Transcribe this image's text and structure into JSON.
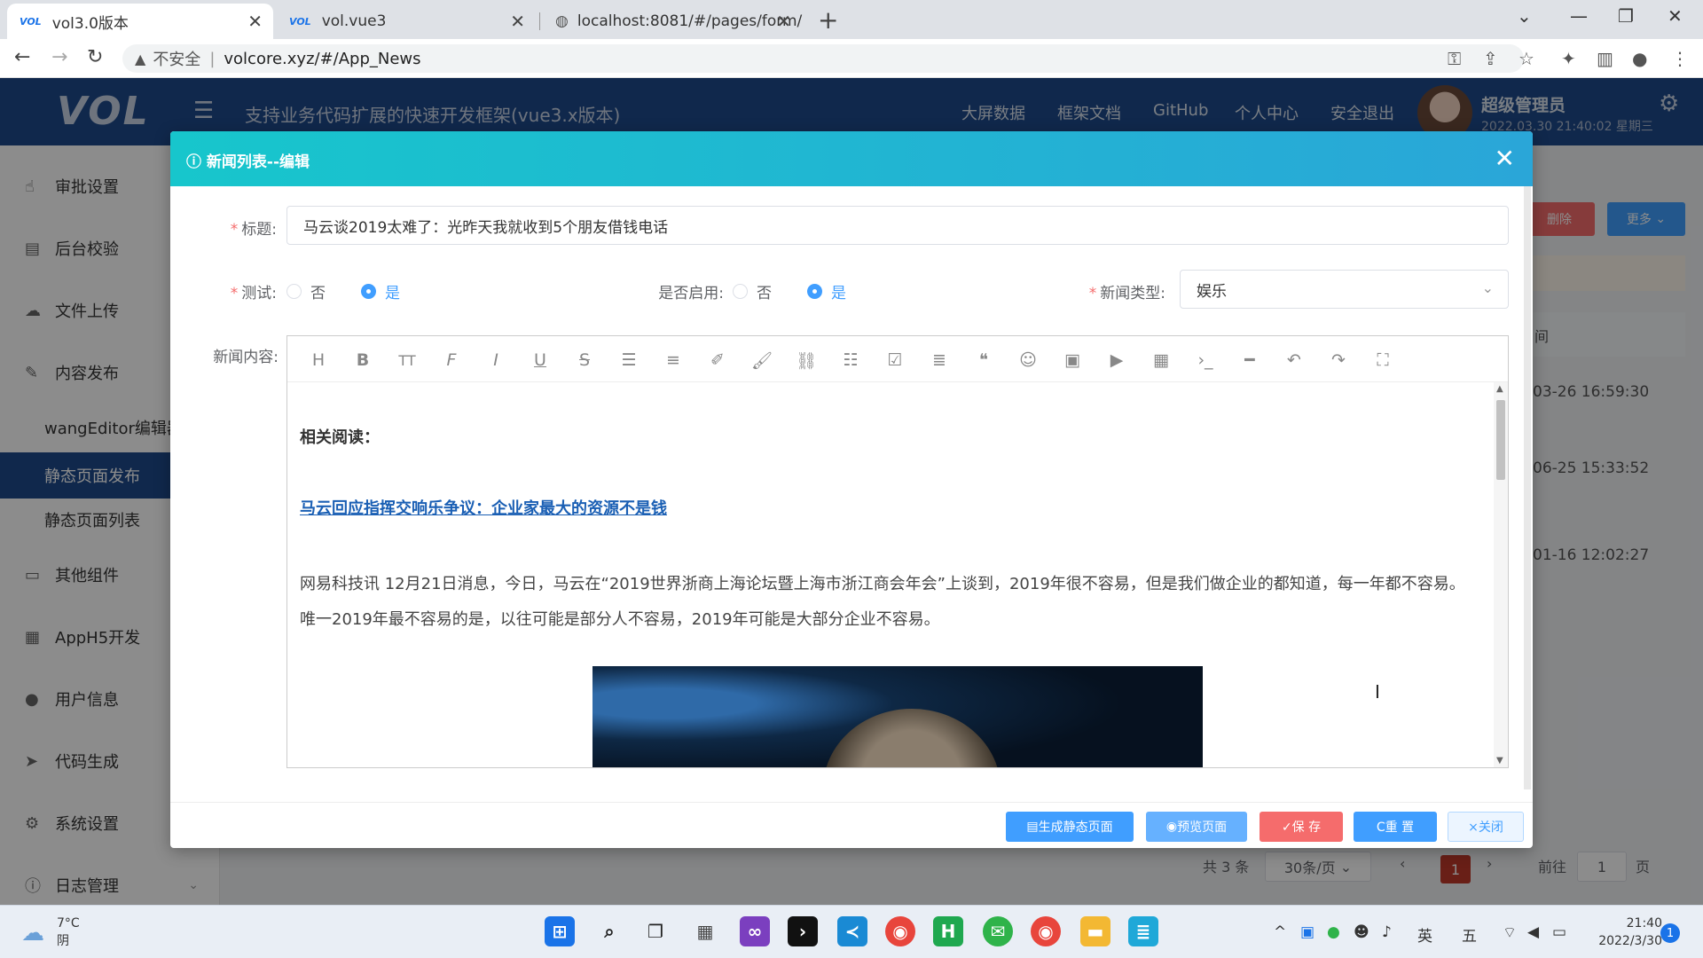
{
  "browser": {
    "tabs": [
      {
        "favicon": "VOL",
        "title": "vol3.0版本"
      },
      {
        "favicon": "VOL",
        "title": "vol.vue3"
      },
      {
        "favicon": "globe-icon",
        "title": "localhost:8081/#/pages/form/"
      }
    ],
    "insecure_label": "不安全",
    "url": "volcore.xyz/#/App_News"
  },
  "app": {
    "logo": "VOL",
    "title": "支持业务代码扩展的快速开发框架(vue3.x版本)",
    "header_links": [
      "大屏数据",
      "框架文档",
      "GitHub",
      "个人中心",
      "安全退出"
    ],
    "user_name": "超级管理员",
    "user_time": "2022.03.30 21:40:02 星期三"
  },
  "sidebar": {
    "items": [
      {
        "icon": "hand-icon",
        "label": "审批设置"
      },
      {
        "icon": "doc-icon",
        "label": "后台校验"
      },
      {
        "icon": "cloud-upload-icon",
        "label": "文件上传"
      },
      {
        "icon": "edit-icon",
        "label": "内容发布"
      },
      {
        "icon": "",
        "label": "wangEditor编辑器"
      },
      {
        "icon": "",
        "label": "静态页面发布"
      },
      {
        "icon": "",
        "label": "静态页面列表"
      },
      {
        "icon": "folder-icon",
        "label": "其他组件"
      },
      {
        "icon": "grid-icon",
        "label": "AppH5开发"
      },
      {
        "icon": "user-icon",
        "label": "用户信息"
      },
      {
        "icon": "send-icon",
        "label": "代码生成"
      },
      {
        "icon": "gear-icon",
        "label": "系统设置"
      },
      {
        "icon": "info-icon",
        "label": "日志管理"
      }
    ]
  },
  "background": {
    "delete_btn": "删除",
    "more_btn": "更多",
    "col_head": "间",
    "times": [
      "03-26 16:59:30",
      "06-25 15:33:52",
      "01-16 12:02:27"
    ],
    "pager": {
      "total": "共 3 条",
      "size": "30条/页",
      "current": "1",
      "goto": "前往",
      "page_input": "1",
      "page_suffix": "页"
    }
  },
  "modal": {
    "title": "新闻列表--编辑",
    "fields": {
      "title_label": "标题:",
      "title_value": "马云谈2019太难了：光昨天我就收到5个朋友借钱电话",
      "test_label": "测试:",
      "test_options": [
        "否",
        "是"
      ],
      "enable_label": "是否启用:",
      "enable_options": [
        "否",
        "是"
      ],
      "type_label": "新闻类型:",
      "type_value": "娱乐",
      "content_label": "新闻内容:"
    },
    "editor": {
      "toolbar": [
        "H",
        "B",
        "TT",
        "F",
        "I",
        "U",
        "S",
        "indent-icon",
        "line-height-icon",
        "pen-icon",
        "brush-icon",
        "link-icon",
        "list-icon",
        "checkbox-icon",
        "align-icon",
        "quote-icon",
        "emoji-icon",
        "image-icon",
        "video-icon",
        "table-icon",
        "code-icon",
        "divider-icon",
        "undo-icon",
        "redo-icon",
        "fullscreen-icon"
      ],
      "heading": "相关阅读：",
      "link": "马云回应指挥交响乐争议：企业家最大的资源不是钱",
      "paragraph": "网易科技讯 12月21日消息，今日，马云在“2019世界浙商上海论坛暨上海市浙江商会年会”上谈到，2019年很不容易，但是我们做企业的都知道，每一年都不容易。唯一2019年最不容易的是，以往可能是部分人不容易，2019年可能是大部分企业不容易。"
    },
    "buttons": {
      "generate": "生成静态页面",
      "preview": "预览页面",
      "save": "✓保 存",
      "reset": "C重 置",
      "close": "×关闭"
    }
  },
  "taskbar": {
    "temp": "7°C",
    "weather": "阴",
    "ime": "英",
    "ime2": "五",
    "time": "21:40",
    "date": "2022/3/30",
    "notif": "1"
  },
  "colors": {
    "header_bg": "#1e4a8a",
    "modal_head": "#17c6cc",
    "primary": "#409eff",
    "danger": "#f56c6c"
  }
}
